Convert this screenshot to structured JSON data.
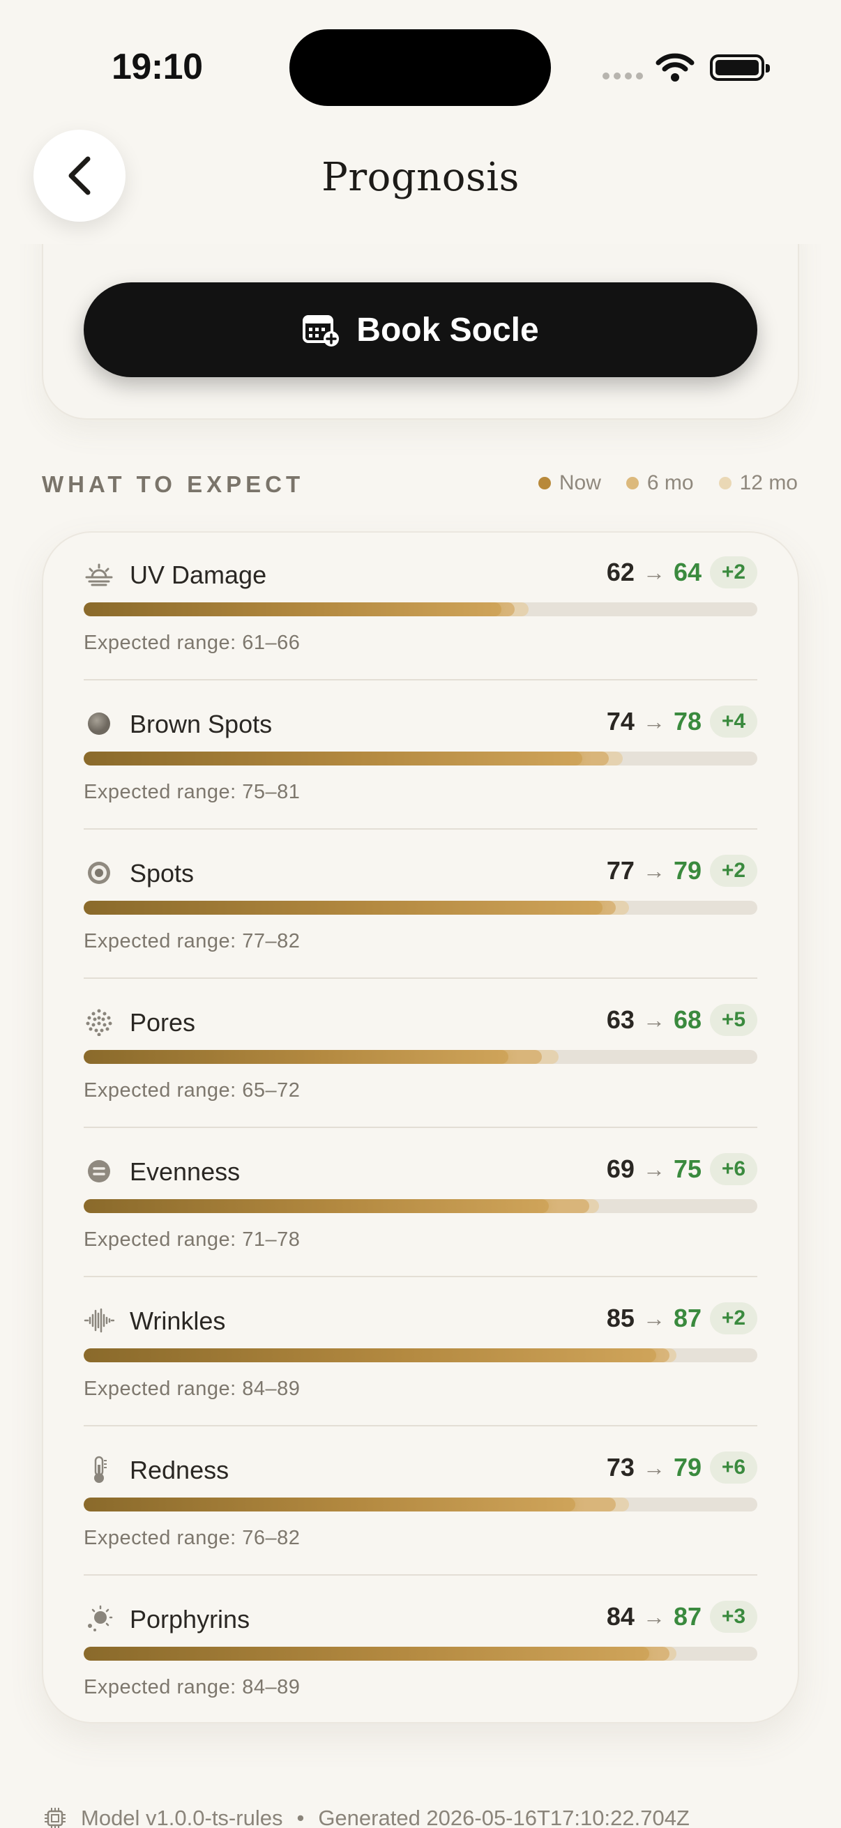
{
  "status_bar": {
    "time": "19:10"
  },
  "header": {
    "title": "Prognosis",
    "back_icon": "chevron-left-icon"
  },
  "booking": {
    "button_label": "Book Socle",
    "button_icon": "calendar-plus-icon"
  },
  "section": {
    "heading": "WHAT TO EXPECT",
    "legend": [
      {
        "label": "Now",
        "color": "#b8893a"
      },
      {
        "label": "6 mo",
        "color": "#dcb97c"
      },
      {
        "label": "12 mo",
        "color": "#ead8b5"
      }
    ]
  },
  "metrics": [
    {
      "name": "UV Damage",
      "icon": "sunrise-icon",
      "now": "62",
      "future": "64",
      "delta": "+2",
      "range": "Expected range: 61–66",
      "now_pct": 62,
      "six_pct": 64,
      "twelve_pct": 66
    },
    {
      "name": "Brown Spots",
      "icon": "dot-filled-icon",
      "now": "74",
      "future": "78",
      "delta": "+4",
      "range": "Expected range: 75–81",
      "now_pct": 74,
      "six_pct": 78,
      "twelve_pct": 80
    },
    {
      "name": "Spots",
      "icon": "target-icon",
      "now": "77",
      "future": "79",
      "delta": "+2",
      "range": "Expected range: 77–82",
      "now_pct": 77,
      "six_pct": 79,
      "twelve_pct": 81
    },
    {
      "name": "Pores",
      "icon": "dots-grid-icon",
      "now": "63",
      "future": "68",
      "delta": "+5",
      "range": "Expected range: 65–72",
      "now_pct": 63,
      "six_pct": 68,
      "twelve_pct": 70.5
    },
    {
      "name": "Evenness",
      "icon": "equals-circle-icon",
      "now": "69",
      "future": "75",
      "delta": "+6",
      "range": "Expected range: 71–78",
      "now_pct": 69,
      "six_pct": 75,
      "twelve_pct": 76.5
    },
    {
      "name": "Wrinkles",
      "icon": "waveform-icon",
      "now": "85",
      "future": "87",
      "delta": "+2",
      "range": "Expected range: 84–89",
      "now_pct": 85,
      "six_pct": 87,
      "twelve_pct": 88
    },
    {
      "name": "Redness",
      "icon": "thermometer-icon",
      "now": "73",
      "future": "79",
      "delta": "+6",
      "range": "Expected range: 76–82",
      "now_pct": 73,
      "six_pct": 79,
      "twelve_pct": 81
    },
    {
      "name": "Porphyrins",
      "icon": "sparkle-sun-icon",
      "now": "84",
      "future": "87",
      "delta": "+3",
      "range": "Expected range: 84–89",
      "now_pct": 84,
      "six_pct": 87,
      "twelve_pct": 88
    }
  ],
  "footer": {
    "icon": "chip-icon",
    "model": "Model v1.0.0-ts-rules",
    "separator": "•",
    "generated": "Generated 2026-05-16T17:10:22.704Z"
  }
}
